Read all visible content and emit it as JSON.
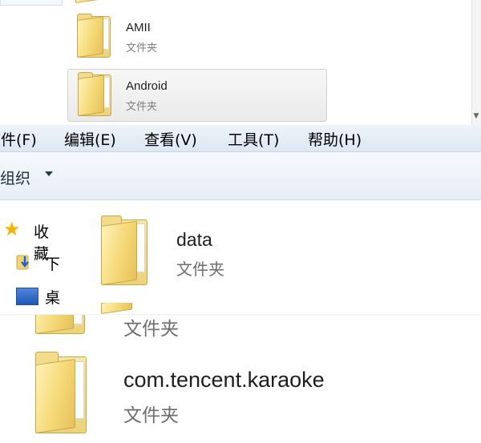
{
  "top_list": {
    "items": [
      {
        "name": "AMII",
        "type": "文件夹",
        "icon": "folder-icon",
        "selected": false
      },
      {
        "name": "Android",
        "type": "文件夹",
        "icon": "folder-icon",
        "selected": true
      }
    ]
  },
  "menubar": {
    "items": [
      {
        "label": "文件(F)"
      },
      {
        "label": "编辑(E)"
      },
      {
        "label": "查看(V)"
      },
      {
        "label": "工具(T)"
      },
      {
        "label": "帮助(H)"
      }
    ]
  },
  "toolbar": {
    "organize_label": "组织"
  },
  "navpane": {
    "items": [
      {
        "label": "收藏",
        "icon": "star-icon"
      },
      {
        "label": "下",
        "icon": "download-folder-icon"
      },
      {
        "label": "桌",
        "icon": "desktop-icon"
      }
    ]
  },
  "content": {
    "items": [
      {
        "name": "data",
        "type": "文件夹",
        "icon": "folder-icon"
      }
    ]
  },
  "bottom_list": {
    "items": [
      {
        "name": "",
        "type": "文件夹",
        "icon": "folder-icon"
      },
      {
        "name": "com.tencent.karaoke",
        "type": "文件夹",
        "icon": "folder-icon"
      }
    ]
  },
  "colors": {
    "folder": "#f2d77a",
    "menubar_bg": "#e6edf7",
    "star": "#f4b400"
  }
}
